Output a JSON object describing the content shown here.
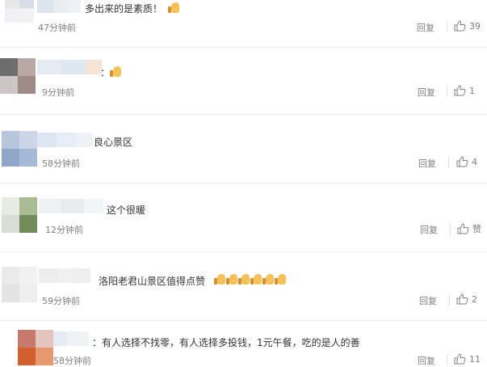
{
  "comments": [
    {
      "text": "多出来的是素质！",
      "time": "47分钟前",
      "reply": "回复",
      "likes": "39",
      "emoji": [
        "thumbs-up"
      ],
      "avatar_colors": [
        "#e8e8e8",
        "#d6dce6",
        "#eef0f4",
        "#f2f2f2"
      ],
      "name_colors": [
        "#dde5ee",
        "#e9ecf1",
        "#eef1f4"
      ]
    },
    {
      "text": "：",
      "time": "9分钟前",
      "reply": "回复",
      "likes": "1",
      "emoji": [
        "thumbs-up"
      ],
      "avatar_colors": [
        "#6d6d6d",
        "#b9a9a4",
        "#cdc6c6",
        "#9f8a86"
      ],
      "name_colors": [
        "#e6ebf2",
        "#dfe7f0",
        "#f3e4d6"
      ]
    },
    {
      "text": "良心景区",
      "time": "58分钟前",
      "reply": "回复",
      "likes": "4",
      "emoji": [],
      "avatar_colors": [
        "#b7c6dc",
        "#cbd6e6",
        "#8fa6c8",
        "#a6b9d4"
      ],
      "name_colors": [
        "#dde6f1",
        "#e7edf4",
        "#eef1f5"
      ]
    },
    {
      "text": "这个很暖",
      "time": "12分钟前",
      "reply": "回复",
      "likes": "赞",
      "emoji": [],
      "avatar_colors": [
        "#e7ece3",
        "#a8bb93",
        "#d8ddd6",
        "#718c5a"
      ],
      "name_colors": [
        "#eef0f2",
        "#e9ecef",
        "#f2f4f5"
      ]
    },
    {
      "text": "洛阳老君山景区值得点赞",
      "time": "59分钟前",
      "reply": "回复",
      "likes": "2",
      "emoji": [
        "thumbs-up",
        "thumbs-up",
        "thumbs-up",
        "thumbs-up",
        "thumbs-up",
        "thumbs-up"
      ],
      "avatar_colors": [
        "#eaeaea",
        "#f1f1f1",
        "#e4e4e4",
        "#eeeeee"
      ],
      "name_colors": [
        "#ededed",
        "#f0f0f0",
        "#eeeeee"
      ]
    },
    {
      "text": "：有人选择不找零，有人选择多投钱，1元午餐，吃的是人的善",
      "time": "58分钟前",
      "reply": "回复",
      "likes": "11",
      "emoji": [],
      "avatar_colors": [
        "#c8796d",
        "#e4c5bd",
        "#d3602f",
        "#e79a6f"
      ],
      "name_colors": [
        "#e4ebf3",
        "#eef2f6",
        "#f2f3f5"
      ]
    }
  ]
}
